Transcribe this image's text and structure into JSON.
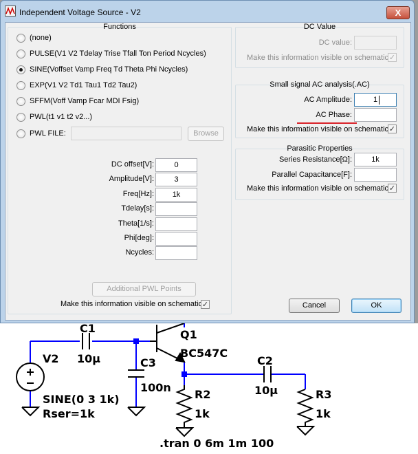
{
  "window": {
    "title": "Independent Voltage Source - V2",
    "close_label": "X"
  },
  "functions": {
    "title": "Functions",
    "options": [
      {
        "label": "(none)",
        "checked": false
      },
      {
        "label": "PULSE(V1 V2 Tdelay Trise Tfall Ton Period Ncycles)",
        "checked": false
      },
      {
        "label": "SINE(Voffset Vamp Freq Td Theta Phi Ncycles)",
        "checked": true
      },
      {
        "label": "EXP(V1 V2 Td1 Tau1 Td2 Tau2)",
        "checked": false
      },
      {
        "label": "SFFM(Voff Vamp Fcar MDI Fsig)",
        "checked": false
      },
      {
        "label": "PWL(t1 v1 t2 v2...)",
        "checked": false
      },
      {
        "label": "PWL FILE:",
        "checked": false
      }
    ],
    "pwl_file_value": "",
    "browse_label": "Browse",
    "params": [
      {
        "label": "DC offset[V]:",
        "value": "0"
      },
      {
        "label": "Amplitude[V]:",
        "value": "3"
      },
      {
        "label": "Freq[Hz]:",
        "value": "1k"
      },
      {
        "label": "Tdelay[s]:",
        "value": ""
      },
      {
        "label": "Theta[1/s]:",
        "value": ""
      },
      {
        "label": "Phi[deg]:",
        "value": ""
      },
      {
        "label": "Ncycles:",
        "value": ""
      }
    ],
    "additional_pwl_label": "Additional PWL Points",
    "visible_on_schematic_label": "Make this information visible on schematic:",
    "visible_checked": true
  },
  "dc_value": {
    "title": "DC Value",
    "label": "DC value:",
    "value": "",
    "visible_label": "Make this information visible on schematic:",
    "visible_checked": true
  },
  "ac": {
    "title": "Small signal AC analysis(.AC)",
    "amplitude_label": "AC Amplitude:",
    "amplitude_value": "1",
    "phase_label": "AC Phase:",
    "phase_value": "",
    "visible_label": "Make this information visible on schematic:",
    "visible_checked": true
  },
  "parasitic": {
    "title": "Parasitic Properties",
    "series_label": "Series Resistance[Ω]:",
    "series_value": "1k",
    "parallel_label": "Parallel Capacitance[F]:",
    "parallel_value": "",
    "visible_label": "Make this information visible on schematic:",
    "visible_checked": true
  },
  "buttons": {
    "cancel": "Cancel",
    "ok": "OK"
  },
  "schematic": {
    "c1": "C1",
    "c1_value": "10µ",
    "q1": "Q1",
    "q1_model": "BC547C",
    "c3": "C3",
    "c3_value": "100n",
    "c2": "C2",
    "c2_value": "10µ",
    "r2": "R2",
    "r2_value": "1k",
    "r3": "R3",
    "r3_value": "1k",
    "v2": "V2",
    "v2_func": "SINE(0 3 1k)",
    "v2_rser": "Rser=1k",
    "tran": ".tran 0 6m 1m 100",
    "wire_color": "#0000ff",
    "part_color": "#000000"
  }
}
